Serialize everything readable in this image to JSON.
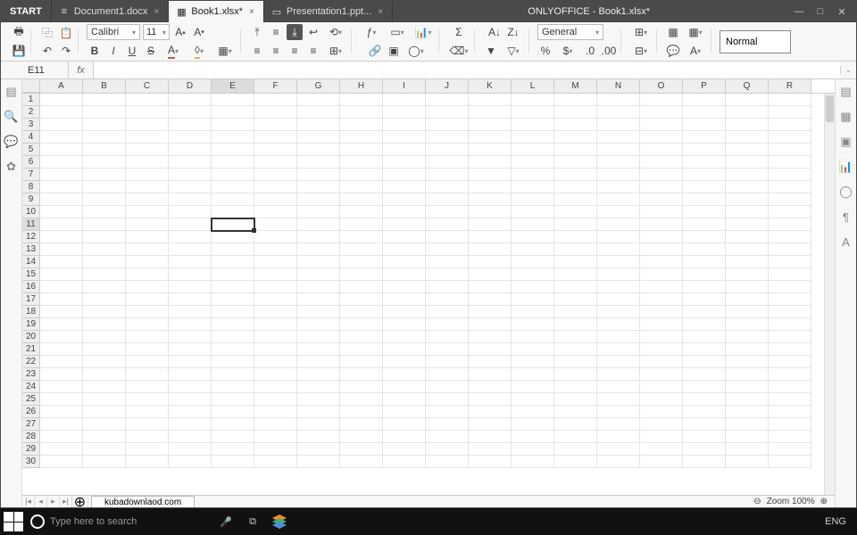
{
  "titlebar": {
    "start": "START",
    "tabs": [
      {
        "icon": "doc-icon",
        "label": "Document1.docx",
        "active": false
      },
      {
        "icon": "sheet-icon",
        "label": "Book1.xlsx*",
        "active": true
      },
      {
        "icon": "pres-icon",
        "label": "Presentation1.ppt...",
        "active": false
      }
    ],
    "title": "ONLYOFFICE - Book1.xlsx*"
  },
  "toolbar": {
    "font": "Calibri",
    "font_size": "11",
    "number_format": "General",
    "style": "Normal"
  },
  "formulabar": {
    "cell_ref": "E11",
    "fx": "fx"
  },
  "grid": {
    "columns": [
      "A",
      "B",
      "C",
      "D",
      "E",
      "F",
      "G",
      "H",
      "I",
      "J",
      "K",
      "L",
      "M",
      "N",
      "O",
      "P",
      "Q",
      "R"
    ],
    "rows": 30,
    "selected": {
      "row": 11,
      "col": "E",
      "colIndex": 4
    }
  },
  "sheettabs": {
    "active": "kubadownlaod.com"
  },
  "status": {
    "zoom_label": "Zoom 100%"
  },
  "taskbar": {
    "search_placeholder": "Type here to search",
    "lang": "ENG"
  }
}
